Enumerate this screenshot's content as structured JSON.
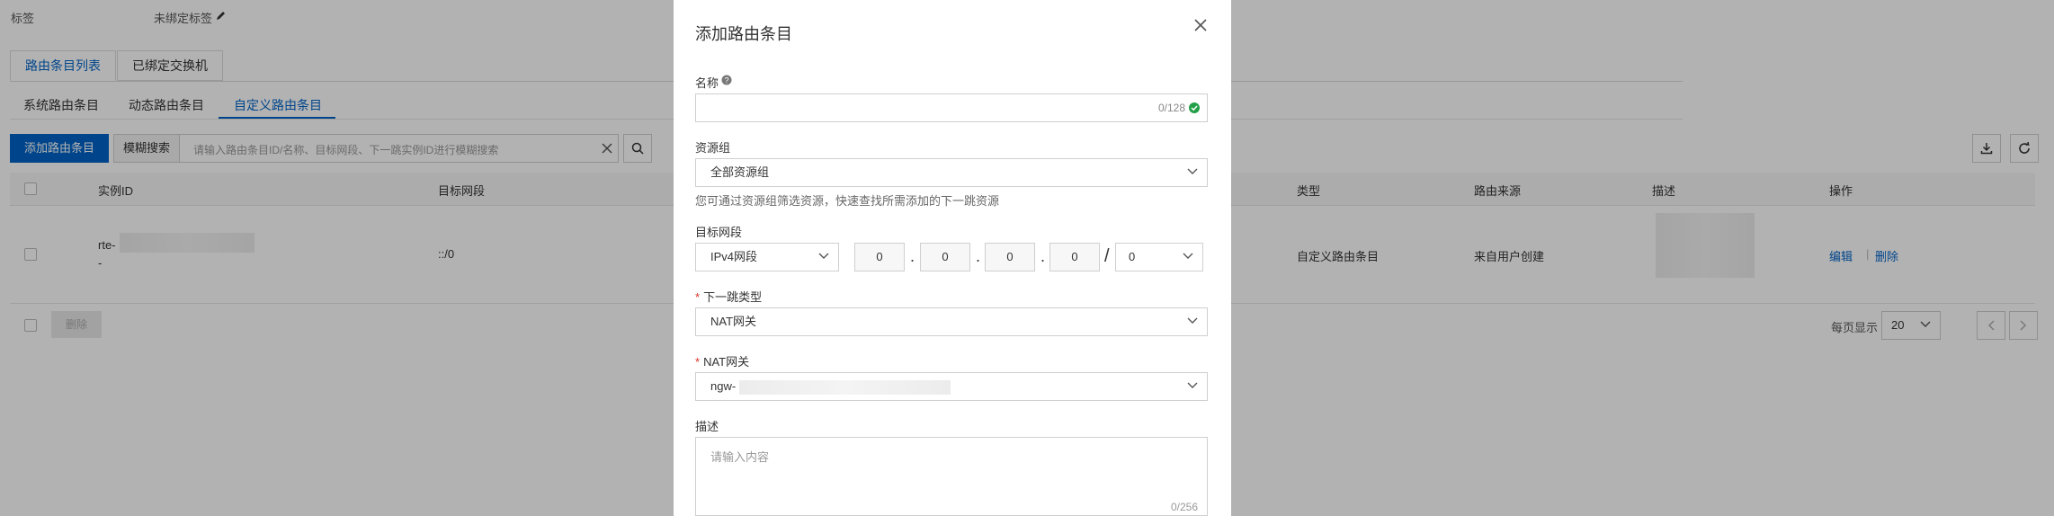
{
  "page": {
    "tag_label": "标签",
    "tag_value": "未绑定标签",
    "tabs": [
      "路由条目列表",
      "已绑定交换机"
    ],
    "subtabs": [
      "系统路由条目",
      "动态路由条目",
      "自定义路由条目"
    ],
    "add_button": "添加路由条目",
    "search_prefix": "模糊搜索",
    "search_placeholder": "请输入路由条目ID/名称、目标网段、下一跳实例ID进行模糊搜索",
    "columns": [
      "实例ID",
      "目标网段",
      "类型",
      "路由来源",
      "描述",
      "操作"
    ],
    "row": {
      "instance_prefix": "rte-",
      "instance_suffix": "-",
      "cidr": "::/0",
      "type": "自定义路由条目",
      "source": "来自用户创建",
      "actions": [
        "编辑",
        "删除"
      ]
    },
    "delete_button": "删除",
    "page_size_label": "每页显示",
    "page_size": "20"
  },
  "dialog": {
    "title": "添加路由条目",
    "name_label": "名称",
    "name_counter": "0/128",
    "rg_label": "资源组",
    "rg_value": "全部资源组",
    "rg_hint": "您可通过资源组筛选资源，快速查找所需添加的下一跳资源",
    "cidr_label": "目标网段",
    "cidr_type": "IPv4网段",
    "ip_octets": [
      "0",
      "0",
      "0",
      "0"
    ],
    "slash": "/",
    "mask": "0",
    "nexthop_type_label": "下一跳类型",
    "nexthop_type_value": "NAT网关",
    "nat_label": "NAT网关",
    "nat_value_prefix": "ngw-",
    "desc_label": "描述",
    "desc_placeholder": "请输入内容",
    "desc_counter": "0/256",
    "required_mark": "*"
  },
  "colors": {
    "accent": "#0064c8",
    "success": "#23a047",
    "required": "#d93026"
  }
}
